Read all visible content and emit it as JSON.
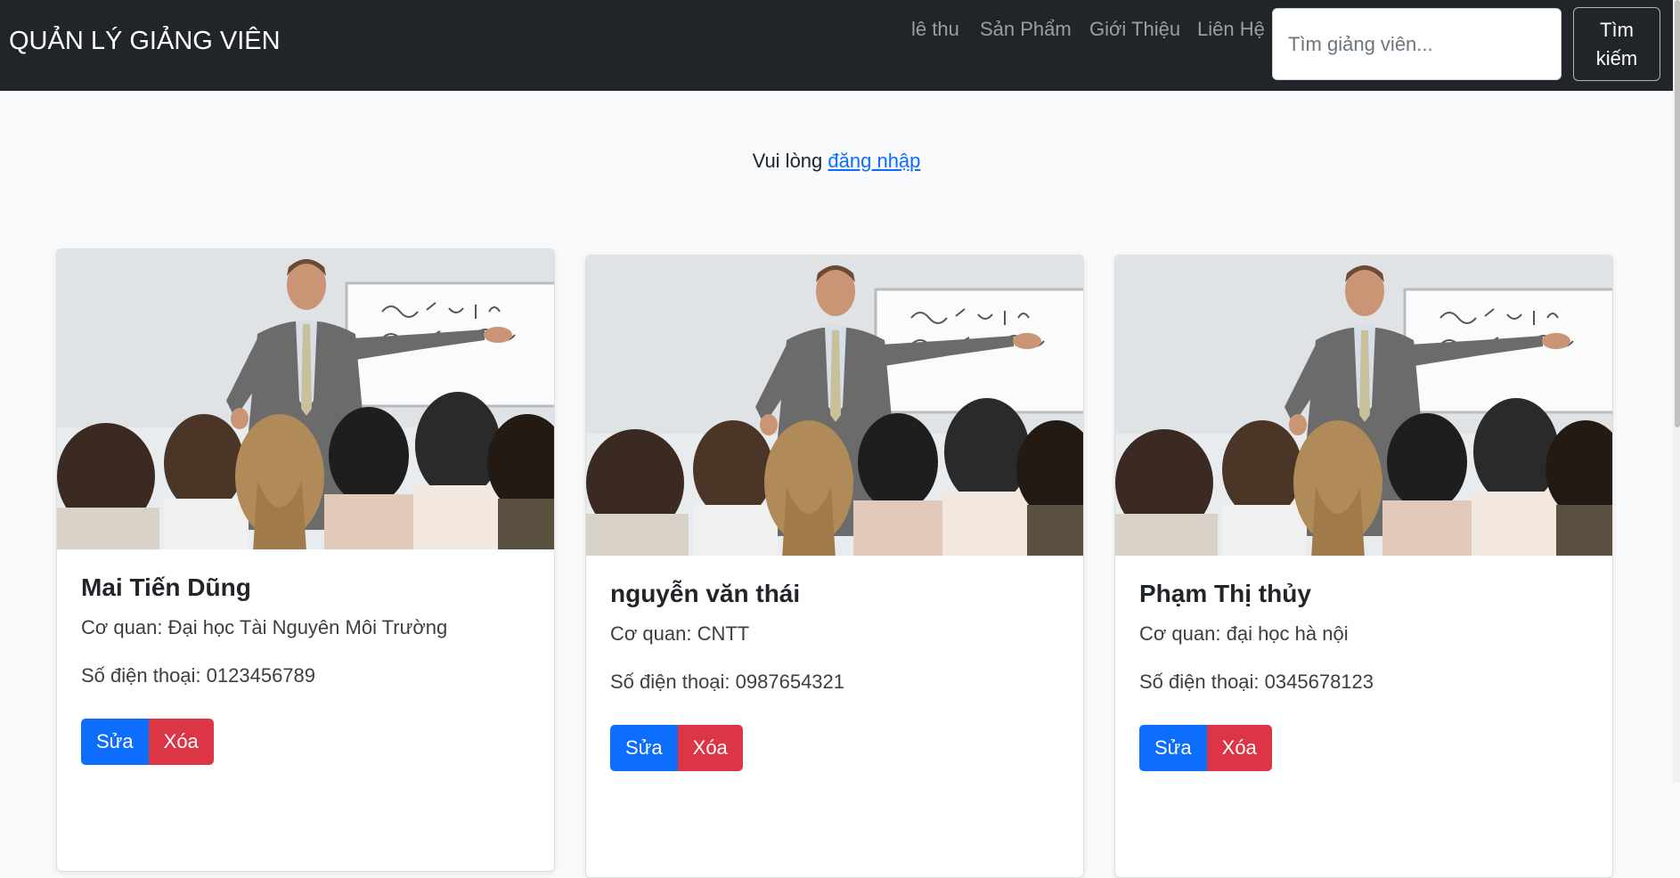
{
  "navbar": {
    "brand": "QUẢN LÝ GIẢNG VIÊN",
    "links": [
      "lê thu",
      "Sản Phẩm",
      "Giới Thiệu",
      "Liên Hệ"
    ],
    "search_placeholder": "Tìm giảng viên...",
    "search_button": "Tìm kiếm"
  },
  "notice": {
    "text": "Vui lòng ",
    "link": "đăng nhập"
  },
  "cards": [
    {
      "name": "Mai Tiến Dũng",
      "agency": "Cơ quan: Đại học Tài Nguyên Môi Trường",
      "phone": "Số điện thoại: 0123456789",
      "edit": "Sửa",
      "delete": "Xóa"
    },
    {
      "name": "nguyễn văn thái",
      "agency": "Cơ quan: CNTT",
      "phone": "Số điện thoại: 0987654321",
      "edit": "Sửa",
      "delete": "Xóa"
    },
    {
      "name": "Phạm Thị thủy",
      "agency": "Cơ quan: đại học hà nội",
      "phone": "Số điện thoại: 0345678123",
      "edit": "Sửa",
      "delete": "Xóa"
    }
  ],
  "colors": {
    "navbar_bg": "#212529",
    "primary": "#0d6efd",
    "danger": "#dc3545",
    "page_bg": "#f8f9fa"
  }
}
